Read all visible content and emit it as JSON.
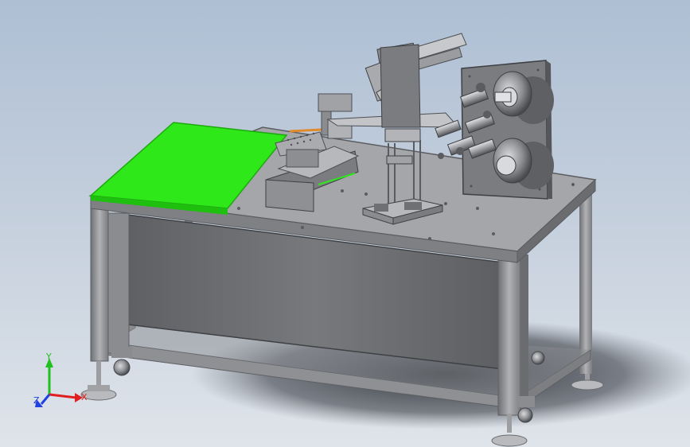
{
  "viewport": {
    "background_top": "#aebfd4",
    "background_bottom": "#dfe4ea"
  },
  "colors": {
    "frame": "#8a8c90",
    "frame_dark": "#5e6064",
    "panel": "#6f7175",
    "top_plate": "#9a9ca0",
    "top_plate_edge": "#6a6c70",
    "green_plate": "#2ee81a",
    "green_plate_edge": "#1da80f",
    "roller_plate": "#7a7c80",
    "orange_accent": "#e08a2a"
  },
  "triad": {
    "x_label": "X",
    "y_label": "Y",
    "z_label": "Z",
    "x_color": "#e02020",
    "y_color": "#20c020",
    "z_color": "#2040e0"
  }
}
